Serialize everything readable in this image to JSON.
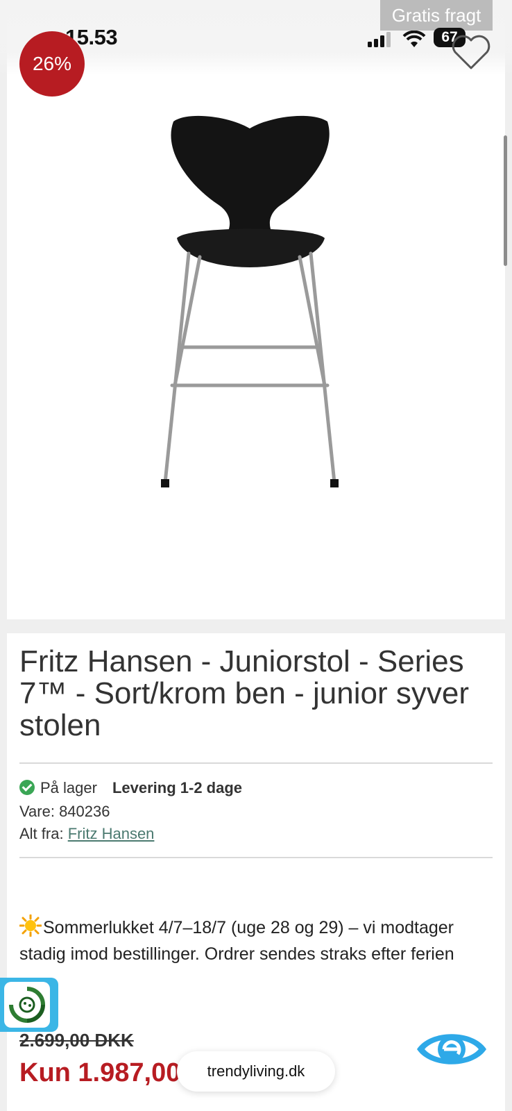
{
  "status_bar": {
    "time": "15.53",
    "battery": "67"
  },
  "promo": {
    "free_shipping": "Gratis fragt"
  },
  "product": {
    "discount_badge": "26%",
    "title": "Fritz Hansen - Juniorstol - Series 7™ - Sort/krom ben - junior syver stolen",
    "stock_status": "På lager",
    "delivery": "Levering 1-2 dage",
    "sku": "Vare: 840236",
    "brand_prefix": "Alt fra:",
    "brand_link": "Fritz Hansen",
    "notice": "Sommerlukket 4/7–18/7 (uge 28 og 29) – vi modtager stadig imod bestillinger. Ordrer sendes straks efter ferien",
    "old_price": "2.699,00 DKK",
    "new_price": "Kun 1.987,00 DKK"
  },
  "browser": {
    "url": "trendyliving.dk"
  },
  "colors": {
    "accent_red": "#b71c22",
    "link_green": "#4b7a70",
    "badge_blue": "#3bb6e6",
    "stock_green": "#3aa655"
  }
}
